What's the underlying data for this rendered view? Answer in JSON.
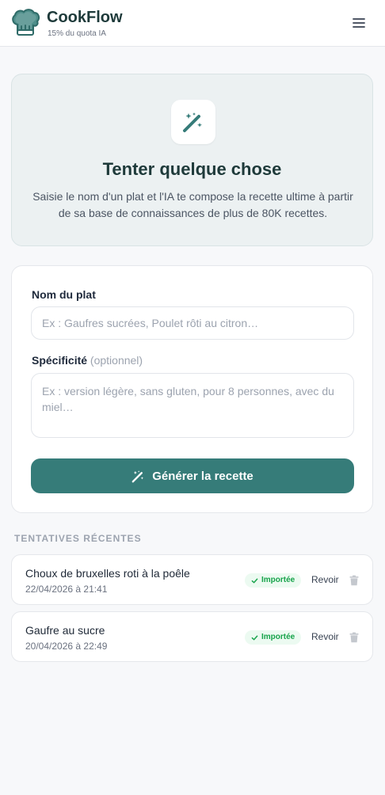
{
  "header": {
    "brand": "CookFlow",
    "quota": "15% du quota IA",
    "logo_icon": "chef-hat-icon",
    "menu_icon": "hamburger-menu-icon"
  },
  "hero": {
    "icon": "magic-wand-icon",
    "title": "Tenter quelque chose",
    "description": "Saisie le nom d'un plat et l'IA te compose la recette ultime à partir de sa base de connaissances de plus de 80K recettes."
  },
  "form": {
    "dish_label": "Nom du plat",
    "dish_value": "",
    "dish_placeholder": "Ex : Gaufres sucrées, Poulet rôti au citron…",
    "spec_label": "Spécificité",
    "spec_optional": "(optionnel)",
    "spec_value": "",
    "spec_placeholder": "Ex : version légère, sans gluten, pour 8 personnes, avec du miel…",
    "generate_label": "Générer la recette"
  },
  "recent": {
    "title": "TENTATIVES RÉCENTES",
    "items": [
      {
        "name": "Choux de bruxelles roti à la poêle",
        "date": "22/04/2026 à 21:41",
        "status": "Importée",
        "action": "Revoir"
      },
      {
        "name": "Gaufre au sucre",
        "date": "20/04/2026 à 22:49",
        "status": "Importée",
        "action": "Revoir"
      }
    ]
  },
  "colors": {
    "accent": "#367c79",
    "brand_text": "#1e3a3a",
    "hero_bg": "#ecf1f2",
    "success": "#16a34a"
  }
}
